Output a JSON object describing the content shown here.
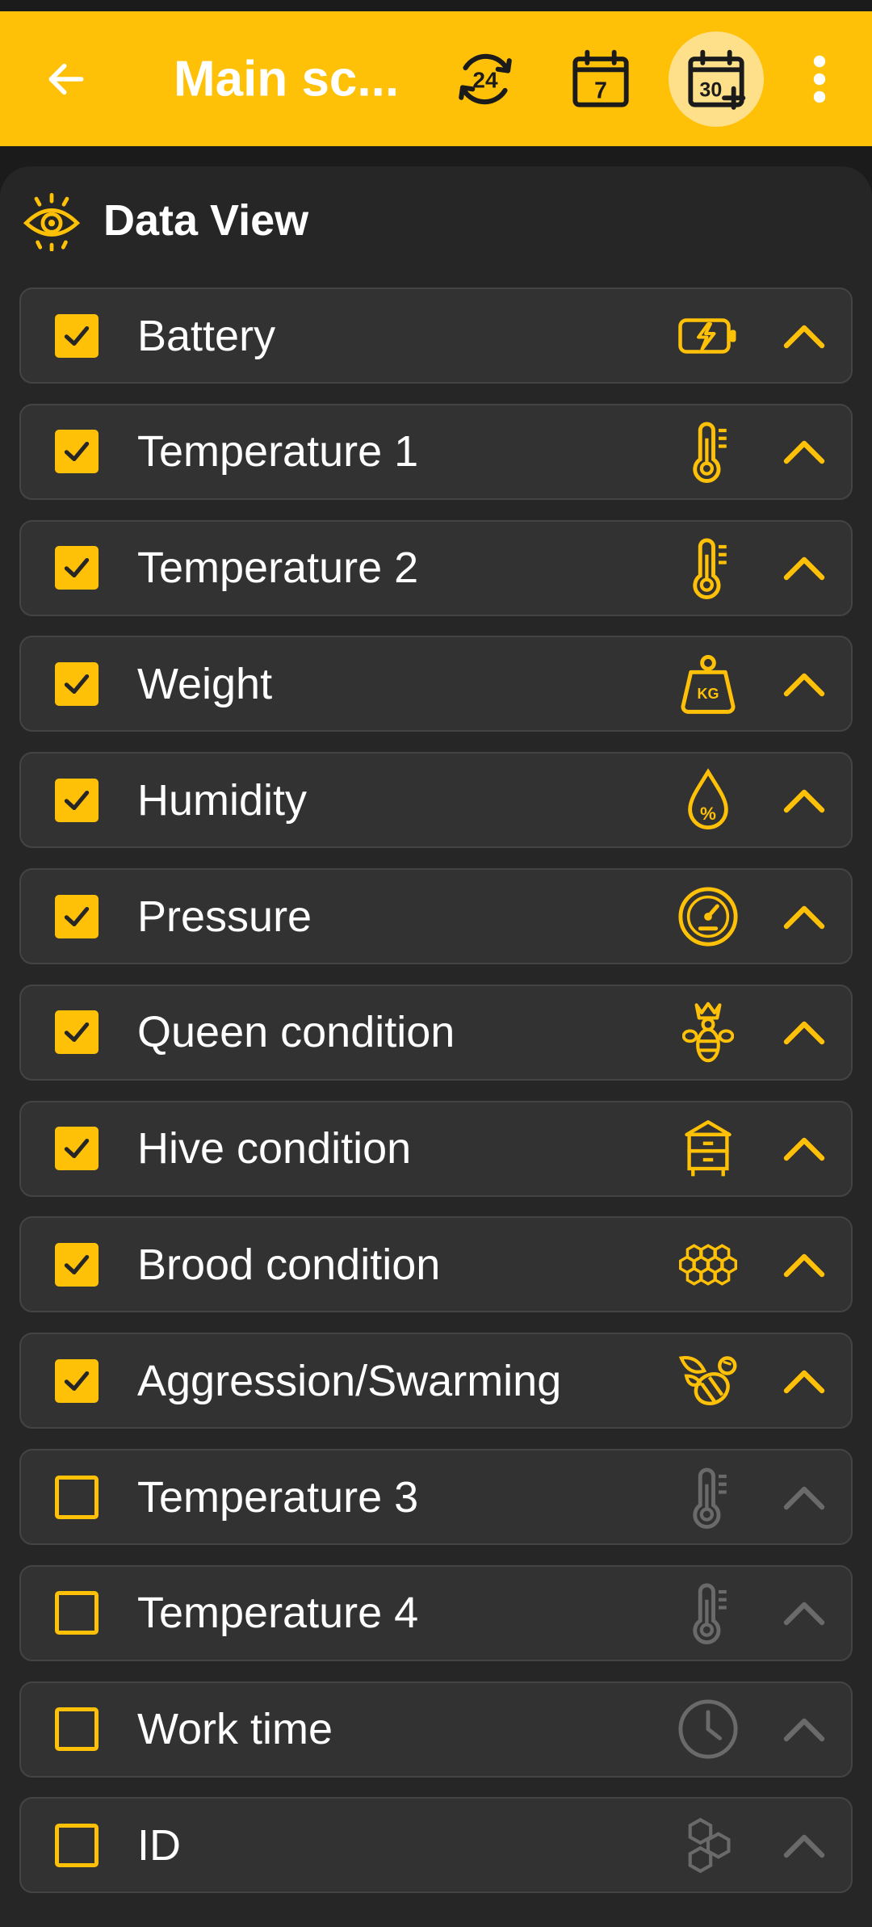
{
  "header": {
    "title": "Main sc...",
    "back_icon": "arrow-left-icon",
    "range_24h_label": "24",
    "range_7d_label": "7",
    "range_30d_label": "30",
    "active_range": "30",
    "menu_icon": "more-vertical-icon",
    "background_color": "#ffc107"
  },
  "panel": {
    "title": "Data View",
    "title_icon": "eye-icon"
  },
  "colors": {
    "accent": "#ffc107",
    "muted": "#6a6a6a",
    "row_bg": "#323232"
  },
  "items": [
    {
      "label": "Battery",
      "checked": true,
      "icon": "battery-icon"
    },
    {
      "label": "Temperature 1",
      "checked": true,
      "icon": "thermometer-icon"
    },
    {
      "label": "Temperature 2",
      "checked": true,
      "icon": "thermometer-icon"
    },
    {
      "label": "Weight",
      "checked": true,
      "icon": "weight-icon",
      "icon_text": "KG"
    },
    {
      "label": "Humidity",
      "checked": true,
      "icon": "humidity-icon",
      "icon_text": "%"
    },
    {
      "label": "Pressure",
      "checked": true,
      "icon": "pressure-gauge-icon"
    },
    {
      "label": "Queen condition",
      "checked": true,
      "icon": "queen-bee-icon"
    },
    {
      "label": "Hive condition",
      "checked": true,
      "icon": "beehive-icon"
    },
    {
      "label": "Brood condition",
      "checked": true,
      "icon": "honeycomb-icon"
    },
    {
      "label": "Aggression/Swarming",
      "checked": true,
      "icon": "angry-bee-icon"
    },
    {
      "label": "Temperature 3",
      "checked": false,
      "icon": "thermometer-icon"
    },
    {
      "label": "Temperature 4",
      "checked": false,
      "icon": "thermometer-icon"
    },
    {
      "label": "Work time",
      "checked": false,
      "icon": "clock-icon"
    },
    {
      "label": "ID",
      "checked": false,
      "icon": "hexagons-icon"
    }
  ]
}
